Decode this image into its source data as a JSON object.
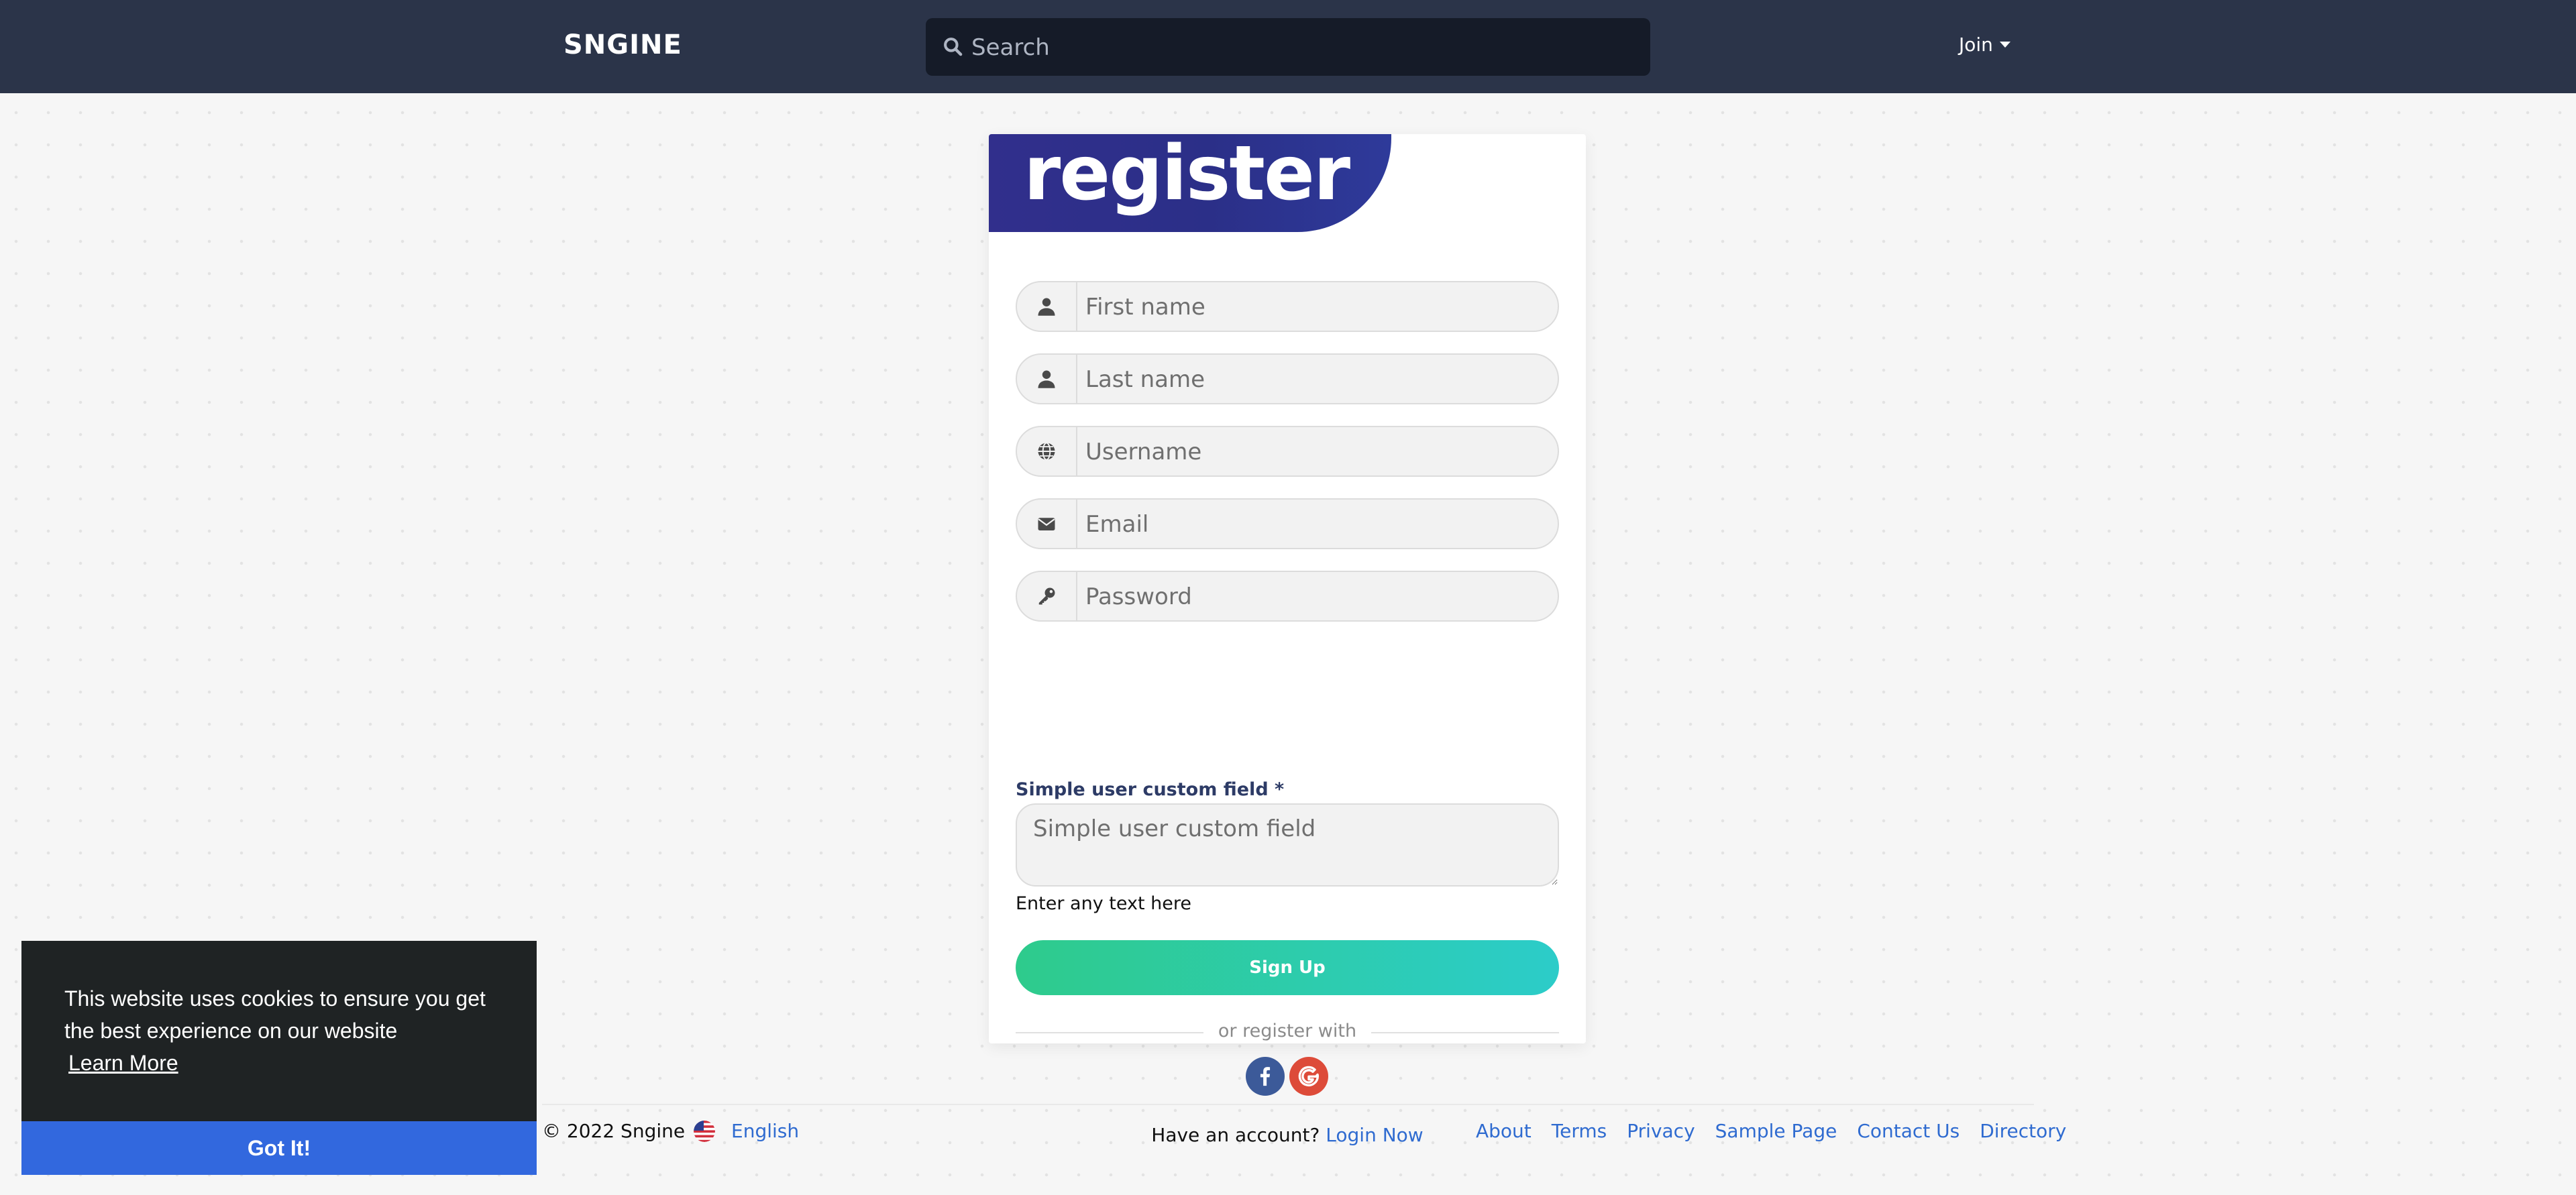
{
  "navbar": {
    "brand": "SNGINE",
    "search_placeholder": "Search",
    "join_label": "Join"
  },
  "register": {
    "title": "register",
    "fields": {
      "first_name": "First name",
      "last_name": "Last name",
      "username": "Username",
      "email": "Email",
      "password": "Password"
    },
    "custom_field": {
      "label": "Simple user custom field *",
      "placeholder": "Simple user custom field",
      "help": "Enter any text here"
    },
    "signup_label": "Sign Up",
    "divider_text": "or register with",
    "have_account": "Have an account?",
    "login_link": "Login Now"
  },
  "footer": {
    "copyright": "© 2022 Sngine",
    "language": "English",
    "links": [
      "About",
      "Terms",
      "Privacy",
      "Sample Page",
      "Contact Us",
      "Directory"
    ]
  },
  "cookie": {
    "message": "This website uses cookies to ensure you get the best experience on our website",
    "learn_more": "Learn More",
    "accept": "Got It!"
  },
  "colors": {
    "navbar_bg": "#2b3449",
    "header_accent": "#312f8c",
    "signup_gradient_start": "#2ecb8c",
    "signup_gradient_end": "#2cccc9",
    "link": "#2f6bd0",
    "cookie_button": "#3268de",
    "facebook": "#3c5a99",
    "google": "#dd4b39"
  }
}
